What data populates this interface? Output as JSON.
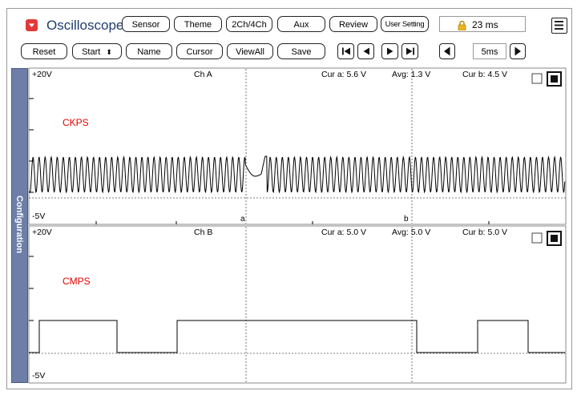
{
  "app": {
    "title": "Oscilloscope"
  },
  "toolbar1": {
    "sensor": "Sensor",
    "theme": "Theme",
    "channels": "2Ch/4Ch",
    "aux": "Aux",
    "review": "Review",
    "user_setting": "User Setting",
    "time_display": "23 ms"
  },
  "toolbar2": {
    "reset": "Reset",
    "start": "Start",
    "name": "Name",
    "cursor": "Cursor",
    "viewall": "ViewAll",
    "save": "Save",
    "timebase": "5ms"
  },
  "sidebar": {
    "label": "Configuration"
  },
  "channel_a": {
    "ymax": "+20V",
    "ymin": "-5V",
    "name": "Ch A",
    "cur_a": "Cur a: 5.6 V",
    "avg": "Avg: 1.3 V",
    "cur_b": "Cur b: 4.5 V",
    "signal": "CKPS",
    "marker_a": "a",
    "marker_b": "b"
  },
  "channel_b": {
    "ymax": "+20V",
    "ymin": "-5V",
    "name": "Ch B",
    "cur_a": "Cur a: 5.0 V",
    "avg": "Avg: 5.0 V",
    "cur_b": "Cur b: 5.0 V",
    "signal": "CMPS"
  },
  "colors": {
    "accent_red": "#e0393a",
    "signal_label": "#e00000",
    "trace": "#000000",
    "sidebar": "#6d7fa8"
  },
  "icons": {
    "menu": "app-menu-icon",
    "lock": "lock-icon",
    "hamburger": "hamburger-menu-icon"
  }
}
